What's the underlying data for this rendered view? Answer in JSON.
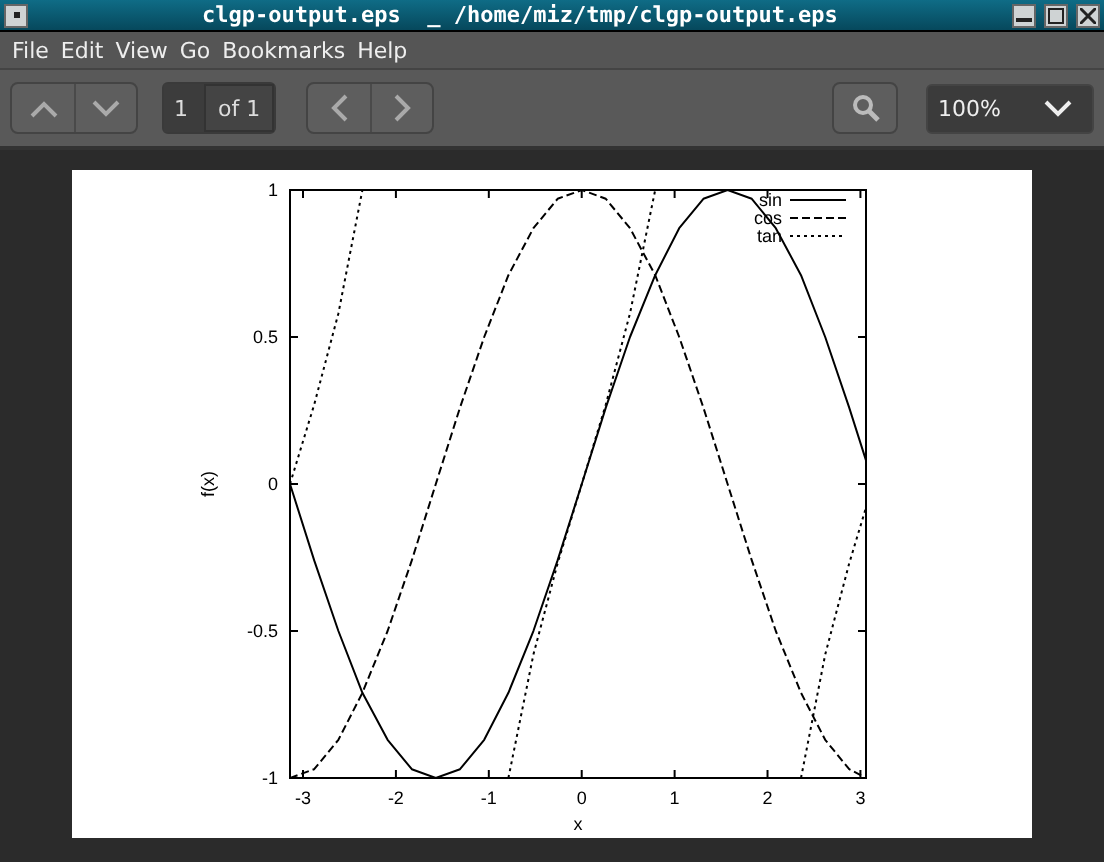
{
  "window": {
    "title": "clgp-output.eps  _ /home/miz/tmp/clgp-output.eps"
  },
  "menu": [
    "File",
    "Edit",
    "View",
    "Go",
    "Bookmarks",
    "Help"
  ],
  "toolbar": {
    "page_number": "1",
    "page_count": "of 1",
    "zoom": "100%"
  },
  "document": {
    "chart_data": {
      "type": "line",
      "xlabel": "x",
      "ylabel": "f(x)",
      "xlim": [
        -3.14,
        3.06
      ],
      "ylim": [
        -1,
        1
      ],
      "xticks": [
        -3,
        -2,
        -1,
        0,
        1,
        2,
        3
      ],
      "yticks": [
        -1,
        -0.5,
        0,
        0.5,
        1
      ],
      "legend": "upper right",
      "x": [
        -3.14,
        -2.88,
        -2.62,
        -2.36,
        -2.09,
        -1.83,
        -1.57,
        -1.31,
        -1.05,
        -0.79,
        -0.52,
        -0.26,
        0,
        0.26,
        0.52,
        0.79,
        1.05,
        1.31,
        1.57,
        1.83,
        2.09,
        2.36,
        2.62,
        2.88,
        3.06
      ],
      "series": [
        {
          "name": "sin",
          "color": "#000000",
          "line_style": "solid",
          "values": [
            0,
            -0.26,
            -0.5,
            -0.71,
            -0.87,
            -0.97,
            -1,
            -0.97,
            -0.87,
            -0.71,
            -0.5,
            -0.26,
            0,
            0.26,
            0.5,
            0.71,
            0.87,
            0.97,
            1,
            0.97,
            0.87,
            0.71,
            0.5,
            0.26,
            0.08
          ]
        },
        {
          "name": "cos",
          "color": "#000000",
          "line_style": "dashed",
          "values": [
            -1,
            -0.97,
            -0.87,
            -0.71,
            -0.5,
            -0.26,
            0,
            0.26,
            0.5,
            0.71,
            0.87,
            0.97,
            1,
            0.97,
            0.87,
            0.71,
            0.5,
            0.26,
            0,
            -0.26,
            -0.5,
            -0.71,
            -0.87,
            -0.97,
            -1
          ]
        },
        {
          "name": "tan",
          "color": "#000000",
          "line_style": "dotted",
          "values": [
            0,
            0.27,
            0.58,
            1,
            null,
            null,
            null,
            null,
            null,
            -1,
            -0.58,
            -0.27,
            0,
            0.27,
            0.58,
            1,
            null,
            null,
            null,
            null,
            null,
            -1,
            -0.58,
            -0.27,
            -0.08
          ]
        }
      ]
    }
  }
}
